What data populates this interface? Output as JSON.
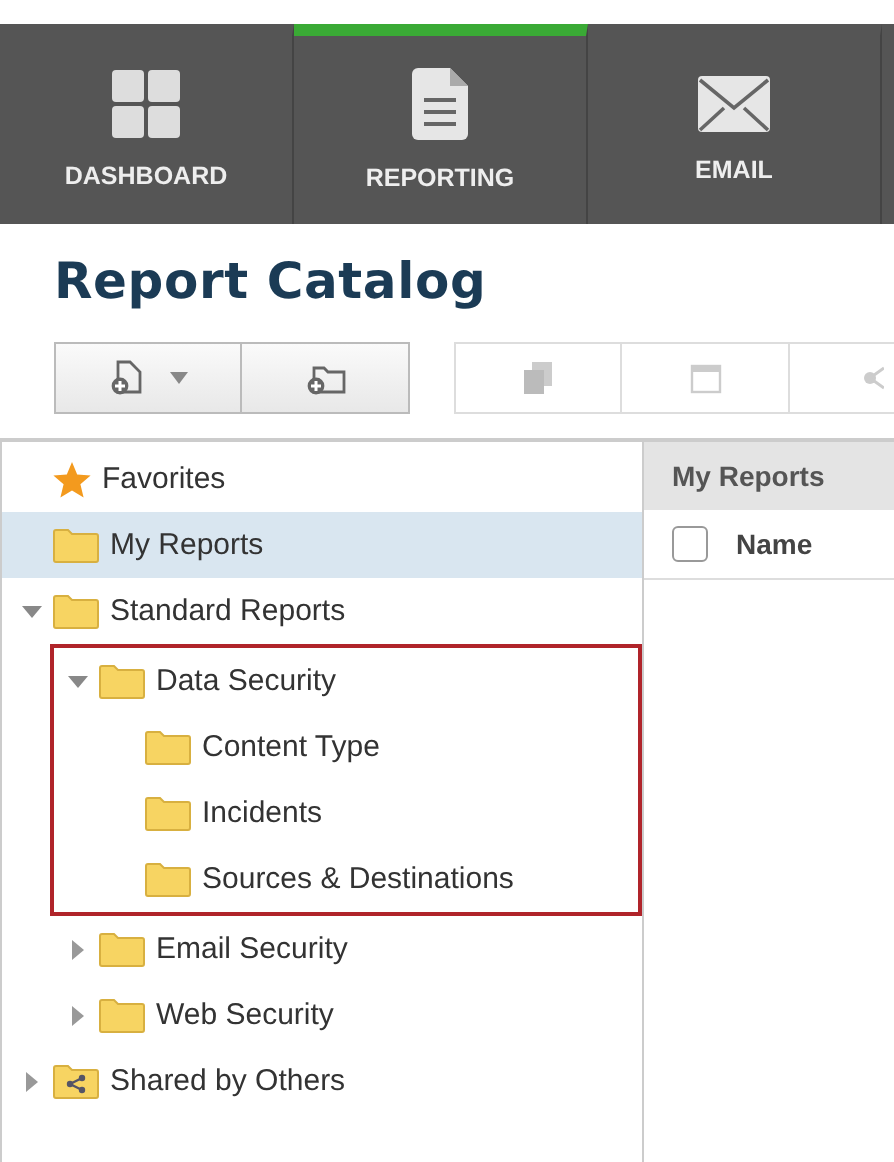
{
  "nav": [
    {
      "label": "DASHBOARD",
      "selected": false
    },
    {
      "label": "REPORTING",
      "selected": true
    },
    {
      "label": "EMAIL",
      "selected": false
    }
  ],
  "title": "Report Catalog",
  "toolbar": [
    {
      "kind": "new",
      "caret": true,
      "disabled": false
    },
    {
      "kind": "folder",
      "caret": false,
      "disabled": false
    },
    {
      "kind": "copy",
      "caret": false,
      "disabled": true
    },
    {
      "kind": "schedule",
      "caret": false,
      "disabled": true
    },
    {
      "kind": "share",
      "caret": false,
      "disabled": true
    }
  ],
  "tree": [
    {
      "label": "Favorites",
      "kind": "favorites",
      "selected": false
    },
    {
      "label": "My Reports",
      "kind": "folder",
      "selected": true
    },
    {
      "label": "Standard Reports",
      "kind": "folder",
      "selected": false,
      "expanded": true,
      "children": [
        {
          "label": "Data Security",
          "kind": "folder",
          "selected": false,
          "expanded": true,
          "highlighted": true,
          "children": [
            {
              "label": "Content Type",
              "kind": "folder",
              "selected": false
            },
            {
              "label": "Incidents",
              "kind": "folder",
              "selected": false
            },
            {
              "label": "Sources & Destinations",
              "kind": "folder",
              "selected": false
            }
          ]
        },
        {
          "label": "Email Security",
          "kind": "folder",
          "selected": false,
          "expanded": false
        },
        {
          "label": "Web Security",
          "kind": "folder",
          "selected": false,
          "expanded": false
        }
      ]
    },
    {
      "label": "Shared by Others",
      "kind": "shared",
      "selected": false,
      "expanded": false
    }
  ],
  "panel": {
    "title": "My Reports",
    "checked": false,
    "columns": [
      {
        "label": "Name"
      }
    ]
  }
}
